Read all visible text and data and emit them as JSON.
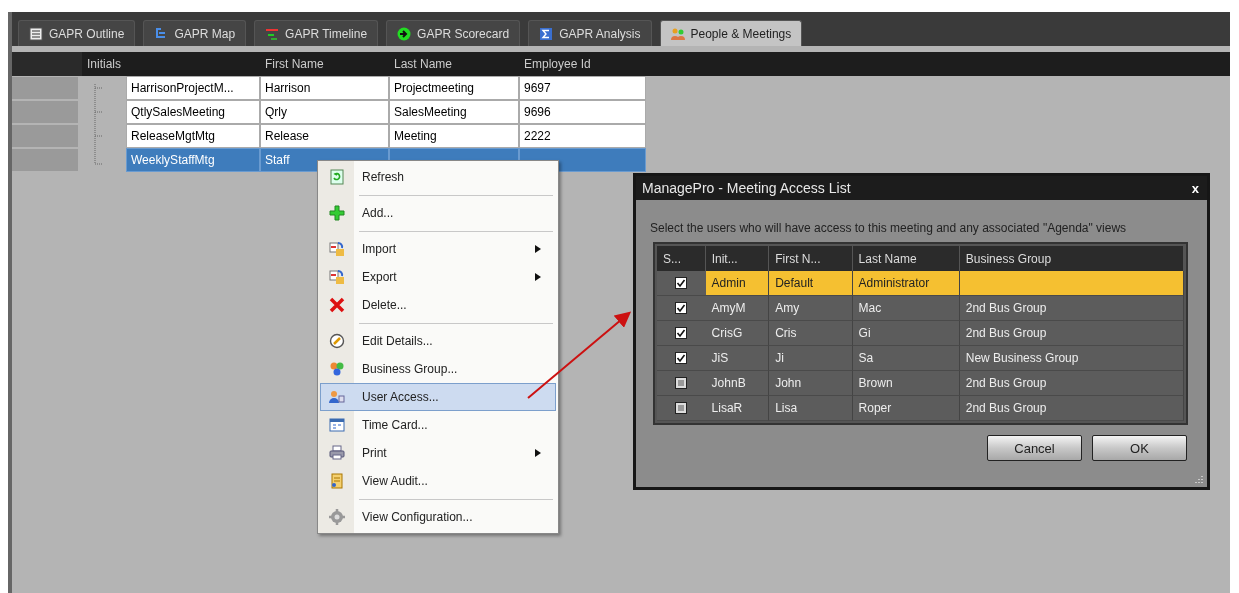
{
  "tabs": [
    {
      "label": "GAPR Outline",
      "selected": false
    },
    {
      "label": "GAPR Map",
      "selected": false
    },
    {
      "label": "GAPR Timeline",
      "selected": false
    },
    {
      "label": "GAPR Scorecard",
      "selected": false
    },
    {
      "label": "GAPR Analysis",
      "selected": false
    },
    {
      "label": "People & Meetings",
      "selected": true
    }
  ],
  "grid": {
    "columns": [
      {
        "label": "Initials"
      },
      {
        "label": "First Name"
      },
      {
        "label": "Last Name"
      },
      {
        "label": "Employee Id"
      }
    ],
    "rows": [
      {
        "selected": false,
        "cells": [
          "HarrisonProjectM...",
          "Harrison",
          "Projectmeeting",
          "9697"
        ]
      },
      {
        "selected": false,
        "cells": [
          "QtlySalesMeeting",
          "Qrly",
          "SalesMeeting",
          "9696"
        ]
      },
      {
        "selected": false,
        "cells": [
          "ReleaseMgtMtg",
          "Release",
          "Meeting",
          "2222"
        ]
      },
      {
        "selected": true,
        "cells": [
          "WeeklyStaffMtg",
          "Staff"
        ]
      }
    ]
  },
  "context_menu": {
    "items": [
      {
        "label": "Refresh",
        "selected": false,
        "submenu": false,
        "separator_before": false
      },
      {
        "label": "Add...",
        "selected": false,
        "submenu": false,
        "separator_before": true
      },
      {
        "label": "Import",
        "selected": false,
        "submenu": true,
        "separator_before": true
      },
      {
        "label": "Export",
        "selected": false,
        "submenu": true,
        "separator_before": false
      },
      {
        "label": "Delete...",
        "selected": false,
        "submenu": false,
        "separator_before": false
      },
      {
        "label": "Edit Details...",
        "selected": false,
        "submenu": false,
        "separator_before": true
      },
      {
        "label": "Business Group...",
        "selected": false,
        "submenu": false,
        "separator_before": false
      },
      {
        "label": "User Access...",
        "selected": true,
        "submenu": false,
        "separator_before": false
      },
      {
        "label": "Time Card...",
        "selected": false,
        "submenu": false,
        "separator_before": false
      },
      {
        "label": "Print",
        "selected": false,
        "submenu": true,
        "separator_before": false
      },
      {
        "label": "View Audit...",
        "selected": false,
        "submenu": false,
        "separator_before": false
      },
      {
        "label": "View Configuration...",
        "selected": false,
        "submenu": false,
        "separator_before": true
      }
    ]
  },
  "dialog": {
    "title": "ManagePro - Meeting Access List",
    "close": "x",
    "instruction": "Select the users who will have access to this meeting and any associated \"Agenda\" views",
    "columns": [
      {
        "label": "S..."
      },
      {
        "label": "Init..."
      },
      {
        "label": "First N..."
      },
      {
        "label": "Last Name"
      },
      {
        "label": "Business Group"
      }
    ],
    "rows": [
      {
        "checked": true,
        "selected": true,
        "cells": [
          "",
          "Admin",
          "Default",
          "Administrator",
          ""
        ]
      },
      {
        "checked": true,
        "selected": false,
        "cells": [
          "",
          "AmyM",
          "Amy",
          "Mac",
          "2nd Bus Group"
        ]
      },
      {
        "checked": true,
        "selected": false,
        "cells": [
          "",
          "CrisG",
          "Cris",
          "Gi",
          "2nd Bus Group"
        ]
      },
      {
        "checked": true,
        "selected": false,
        "cells": [
          "",
          "JiS",
          "Ji",
          "Sa",
          "New Business Group"
        ]
      },
      {
        "checked": false,
        "selected": false,
        "cells": [
          "",
          "JohnB",
          "John",
          "Brown",
          "2nd Bus Group"
        ]
      },
      {
        "checked": false,
        "selected": false,
        "cells": [
          "",
          "LisaR",
          "Lisa",
          "Roper",
          "2nd Bus Group"
        ]
      }
    ],
    "buttons": [
      "Cancel",
      "OK"
    ]
  }
}
